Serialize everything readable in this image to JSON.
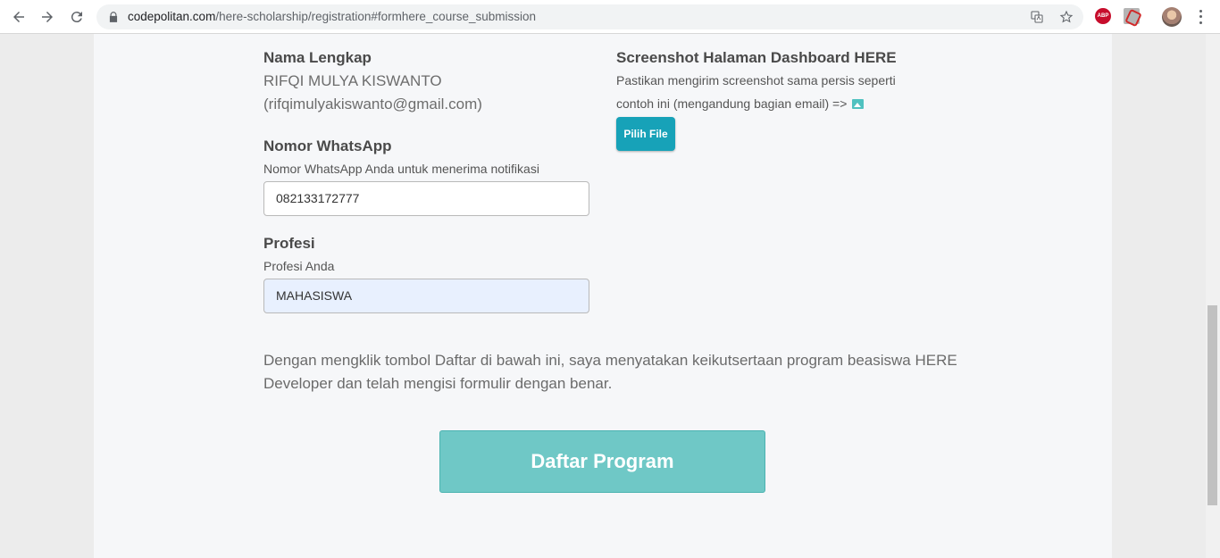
{
  "browser": {
    "url_host": "codepolitan.com",
    "url_path": "/here-scholarship/registration#formhere_course_submission",
    "extensions": {
      "abp_label": "ABP"
    }
  },
  "form": {
    "name": {
      "label": "Nama Lengkap",
      "value": "RIFQI MULYA KISWANTO",
      "email": "(rifqimulyakiswanto@gmail.com)"
    },
    "whatsapp": {
      "label": "Nomor WhatsApp",
      "help": "Nomor WhatsApp Anda untuk menerima notifikasi",
      "value": "082133172777"
    },
    "profession": {
      "label": "Profesi",
      "help": "Profesi Anda",
      "value": "MAHASISWA"
    },
    "screenshot": {
      "label": "Screenshot Halaman Dashboard HERE",
      "help_line1": "Pastikan mengirim screenshot sama persis seperti",
      "help_line2": "contoh ini (mengandung bagian email) =>",
      "button_label": "Pilih File"
    },
    "disclaimer": "Dengan mengklik tombol Daftar di bawah ini, saya menyatakan keikutsertaan program beasiswa HERE Developer dan telah mengisi formulir dengan benar.",
    "submit_label": "Daftar Program"
  },
  "colors": {
    "accent": "#17a2b8",
    "submit": "#6fc8c6"
  }
}
